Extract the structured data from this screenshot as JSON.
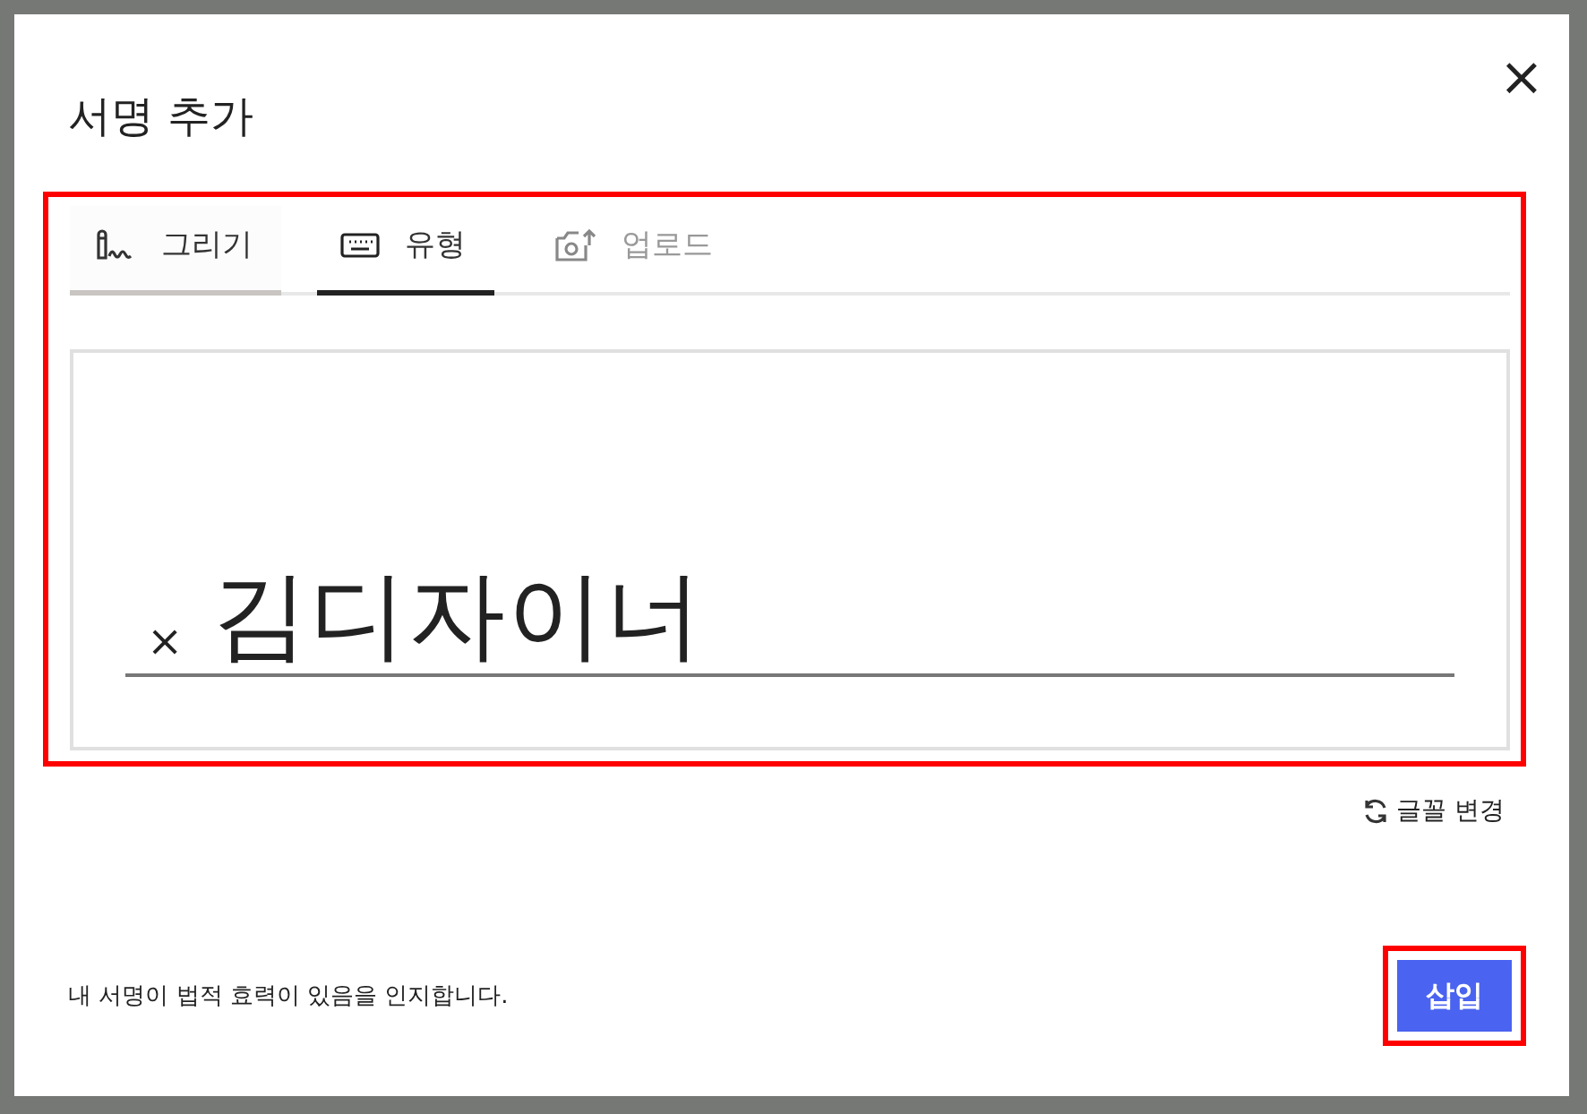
{
  "dialog": {
    "title": "서명 추가",
    "close": "×"
  },
  "tabs": [
    {
      "label": "그리기",
      "selected": false,
      "hovered": true,
      "disabled": false
    },
    {
      "label": "유형",
      "selected": true,
      "hovered": false,
      "disabled": false
    },
    {
      "label": "업로드",
      "selected": false,
      "hovered": false,
      "disabled": true
    }
  ],
  "signature": {
    "clear": "×",
    "value": "김디자이너"
  },
  "change_font": "글꼴 변경",
  "footer": {
    "note": "내 서명이 법적 효력이 있음을 인지합니다.",
    "button": "삽입"
  },
  "highlights": {
    "tab_panel": true,
    "insert_button": true
  }
}
